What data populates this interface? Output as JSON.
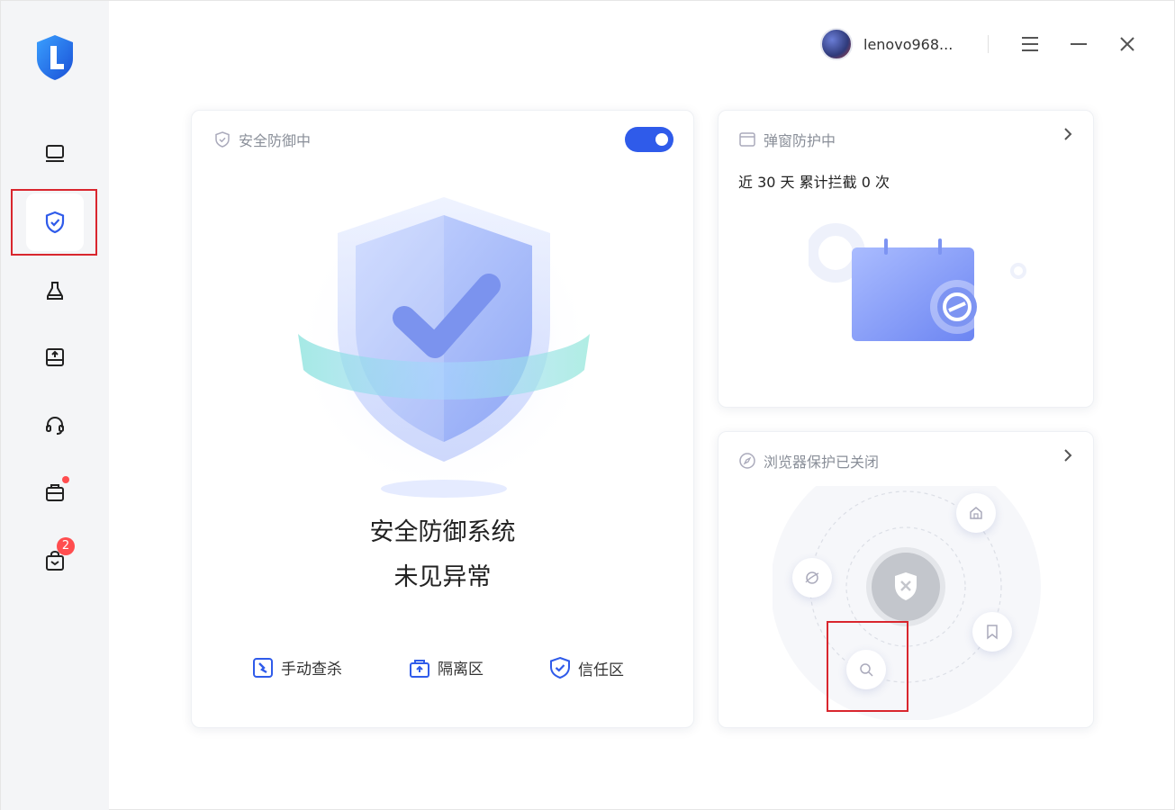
{
  "user": {
    "name": "lenovo968..."
  },
  "sidebar": {
    "items": [
      {
        "icon": "monitor-icon"
      },
      {
        "icon": "shield-check-icon",
        "active": true
      },
      {
        "icon": "cleaner-icon"
      },
      {
        "icon": "disk-icon"
      },
      {
        "icon": "headset-icon"
      },
      {
        "icon": "toolbox-icon",
        "dot": true
      },
      {
        "icon": "bag-icon",
        "badge": "2"
      }
    ]
  },
  "defense_card": {
    "title": "安全防御中",
    "toggle_on": true,
    "status_line1": "安全防御系统",
    "status_line2": "未见异常",
    "actions": [
      {
        "label": "手动查杀",
        "icon": "manual-scan-icon"
      },
      {
        "label": "隔离区",
        "icon": "quarantine-icon"
      },
      {
        "label": "信任区",
        "icon": "trust-zone-icon"
      }
    ]
  },
  "popup_card": {
    "title": "弹窗防护中",
    "intercept_text": "近 30 天 累计拦截 0 次"
  },
  "browser_card": {
    "title": "浏览器保护已关闭"
  },
  "colors": {
    "accent": "#2f5bea",
    "highlight": "#d9262e"
  }
}
